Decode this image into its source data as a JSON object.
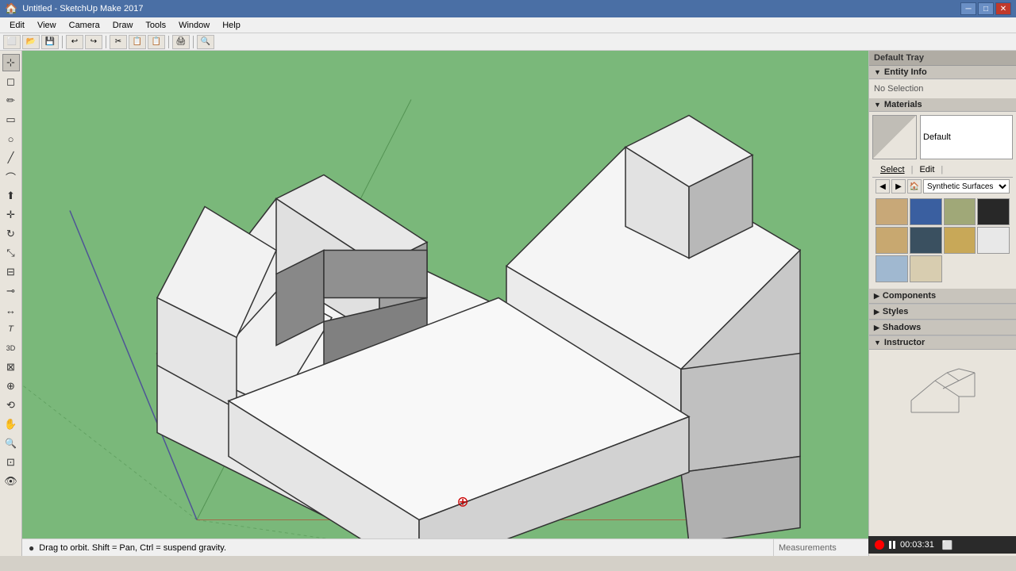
{
  "titlebar": {
    "title": "Untitled - SketchUp Make 2017",
    "min_btn": "─",
    "max_btn": "□",
    "close_btn": "✕"
  },
  "menubar": {
    "items": [
      "Edit",
      "View",
      "Camera",
      "Draw",
      "Tools",
      "Window",
      "Help"
    ]
  },
  "toolbar": {
    "buttons": [
      "⬜",
      "⚙",
      "📋",
      "✂",
      "📂",
      "💾",
      "↩",
      "↪",
      "🖨",
      "🔍"
    ]
  },
  "left_tools": [
    {
      "name": "select",
      "icon": "⊹"
    },
    {
      "name": "erase",
      "icon": "◻"
    },
    {
      "name": "paint",
      "icon": "✏"
    },
    {
      "name": "rectangle",
      "icon": "▭"
    },
    {
      "name": "circle",
      "icon": "○"
    },
    {
      "name": "line",
      "icon": "╱"
    },
    {
      "name": "arc",
      "icon": "⌒"
    },
    {
      "name": "push-pull",
      "icon": "⬆"
    },
    {
      "name": "move",
      "icon": "✛"
    },
    {
      "name": "rotate",
      "icon": "↻"
    },
    {
      "name": "scale",
      "icon": "⤡"
    },
    {
      "name": "offset",
      "icon": "⊟"
    },
    {
      "name": "tape",
      "icon": "⊸"
    },
    {
      "name": "dimension",
      "icon": "↔"
    },
    {
      "name": "text",
      "icon": "A"
    },
    {
      "name": "3d-text",
      "icon": "A"
    },
    {
      "name": "section",
      "icon": "⊠"
    },
    {
      "name": "axes",
      "icon": "⊕"
    },
    {
      "name": "orbit",
      "icon": "⟲"
    },
    {
      "name": "pan",
      "icon": "✋"
    },
    {
      "name": "zoom",
      "icon": "🔍"
    },
    {
      "name": "zoom-extents",
      "icon": "⊡"
    },
    {
      "name": "look-around",
      "icon": "👁"
    }
  ],
  "status_bar": {
    "icon": "●",
    "message": "Drag to orbit. Shift = Pan, Ctrl = suspend gravity."
  },
  "measurements": {
    "label": "Measurements"
  },
  "right_panel": {
    "tray_title": "Default Tray",
    "entity_info": {
      "title": "Entity Info",
      "arrow": "▼",
      "content": "No Selection"
    },
    "materials": {
      "title": "Materials",
      "arrow": "▼",
      "current_name": "Default",
      "select_tab": "Select",
      "edit_tab": "Edit",
      "category": "Synthetic Surfaces",
      "colors": [
        {
          "name": "tan",
          "hex": "#c8a878"
        },
        {
          "name": "blue",
          "hex": "#3a5fa0"
        },
        {
          "name": "sage",
          "hex": "#a0a878"
        },
        {
          "name": "dark",
          "hex": "#282828"
        },
        {
          "name": "tan2",
          "hex": "#c8a870"
        },
        {
          "name": "darkblue",
          "hex": "#3a5060"
        },
        {
          "name": "gold",
          "hex": "#c8a858"
        },
        {
          "name": "white",
          "hex": "#e8e8e8"
        },
        {
          "name": "lightblue",
          "hex": "#a0b8d0"
        },
        {
          "name": "cream",
          "hex": "#d8cdb0"
        }
      ]
    },
    "components": {
      "title": "Components",
      "arrow": "▶"
    },
    "styles": {
      "title": "Styles",
      "arrow": "▶"
    },
    "shadows": {
      "title": "Shadows",
      "arrow": "▶"
    },
    "instructor": {
      "title": "Instructor",
      "arrow": "▼"
    }
  },
  "recording": {
    "time": "00:03:31"
  },
  "viewport_bg": "#7ab87a"
}
